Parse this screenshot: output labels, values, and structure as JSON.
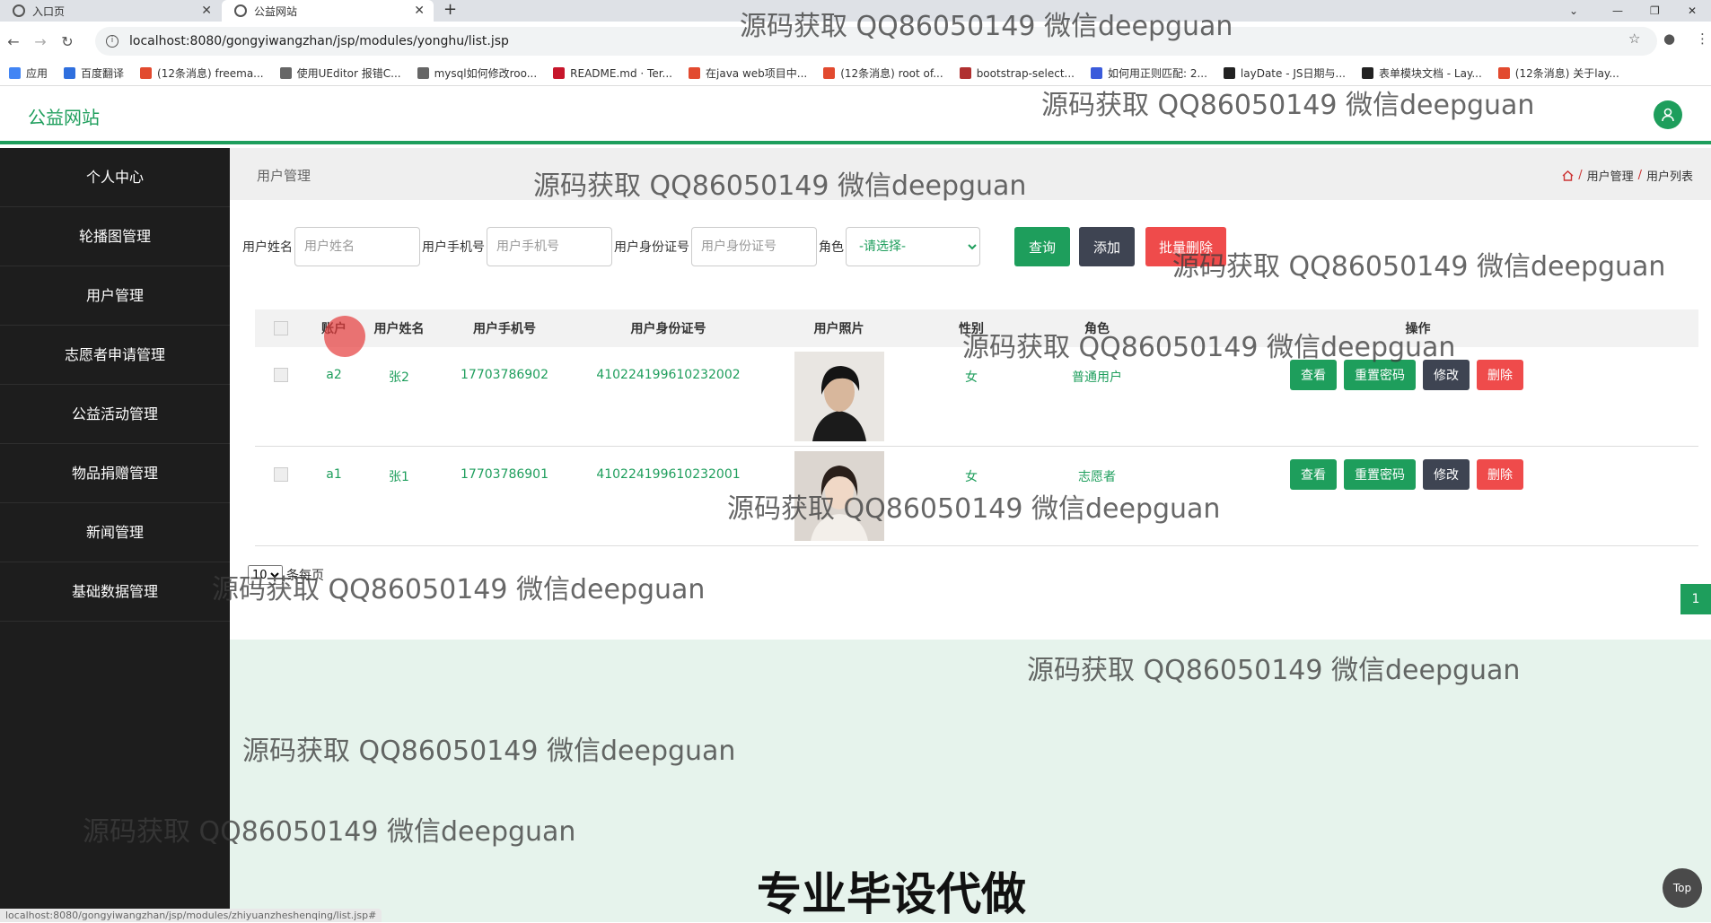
{
  "browser": {
    "tabs": [
      {
        "title": "入口页"
      },
      {
        "title": "公益网站"
      }
    ],
    "new_tab": "+",
    "url": "localhost:8080/gongyiwangzhan/jsp/modules/yonghu/list.jsp",
    "bookmarks": [
      {
        "label": "应用",
        "color": "#4285f4"
      },
      {
        "label": "百度翻译",
        "color": "#2f6fde"
      },
      {
        "label": "(12条消息) freema...",
        "color": "#e24a2f"
      },
      {
        "label": "使用UEditor 报错C...",
        "color": "#666666"
      },
      {
        "label": "mysql如何修改roo...",
        "color": "#666666"
      },
      {
        "label": "README.md · Ter...",
        "color": "#c7162b"
      },
      {
        "label": "在java web项目中...",
        "color": "#e24a2f"
      },
      {
        "label": "(12条消息) root of...",
        "color": "#e24a2f"
      },
      {
        "label": "bootstrap-select...",
        "color": "#b03030"
      },
      {
        "label": "如何用正则匹配: 2...",
        "color": "#3b5bdb"
      },
      {
        "label": "layDate - JS日期与...",
        "color": "#222222"
      },
      {
        "label": "表单模块文档 - Lay...",
        "color": "#222222"
      },
      {
        "label": "(12条消息) 关于lay...",
        "color": "#e24a2f"
      }
    ],
    "status_url": "localhost:8080/gongyiwangzhan/jsp/modules/zhiyuanzheshenqing/list.jsp#"
  },
  "site": {
    "logo": "公益网站",
    "brand_color": "#1e9e5c"
  },
  "sidebar": {
    "items": [
      {
        "label": "个人中心"
      },
      {
        "label": "轮播图管理"
      },
      {
        "label": "用户管理"
      },
      {
        "label": "志愿者申请管理"
      },
      {
        "label": "公益活动管理"
      },
      {
        "label": "物品捐赠管理"
      },
      {
        "label": "新闻管理"
      },
      {
        "label": "基础数据管理"
      }
    ]
  },
  "page": {
    "title": "用户管理",
    "breadcrumb": [
      "用户管理",
      "用户列表"
    ]
  },
  "search": {
    "name_label": "用户姓名",
    "name_placeholder": "用户姓名",
    "phone_label": "用户手机号",
    "phone_placeholder": "用户手机号",
    "id_label": "用户身份证号",
    "id_placeholder": "用户身份证号",
    "role_label": "角色",
    "role_value": "-请选择-",
    "query_label": "查询",
    "add_label": "添加",
    "batch_delete_label": "批量删除"
  },
  "table": {
    "columns": [
      "账户",
      "用户姓名",
      "用户手机号",
      "用户身份证号",
      "用户照片",
      "性别",
      "角色",
      "操作"
    ],
    "rows": [
      {
        "account": "a2",
        "name": "张2",
        "phone": "17703786902",
        "id_card": "410224199610232002",
        "sex": "女",
        "role": "普通用户"
      },
      {
        "account": "a1",
        "name": "张1",
        "phone": "17703786901",
        "id_card": "410224199610232001",
        "sex": "女",
        "role": "志愿者"
      }
    ],
    "actions": {
      "view": "查看",
      "reset": "重置密码",
      "edit": "修改",
      "delete": "删除"
    }
  },
  "pager": {
    "page_size": "10",
    "per_page_label": "条每页",
    "current_page": "1"
  },
  "overlay": {
    "watermark": "源码获取 QQ86050149 微信deepguan",
    "bottom_text": "专业毕设代做",
    "top_button": "Top"
  }
}
